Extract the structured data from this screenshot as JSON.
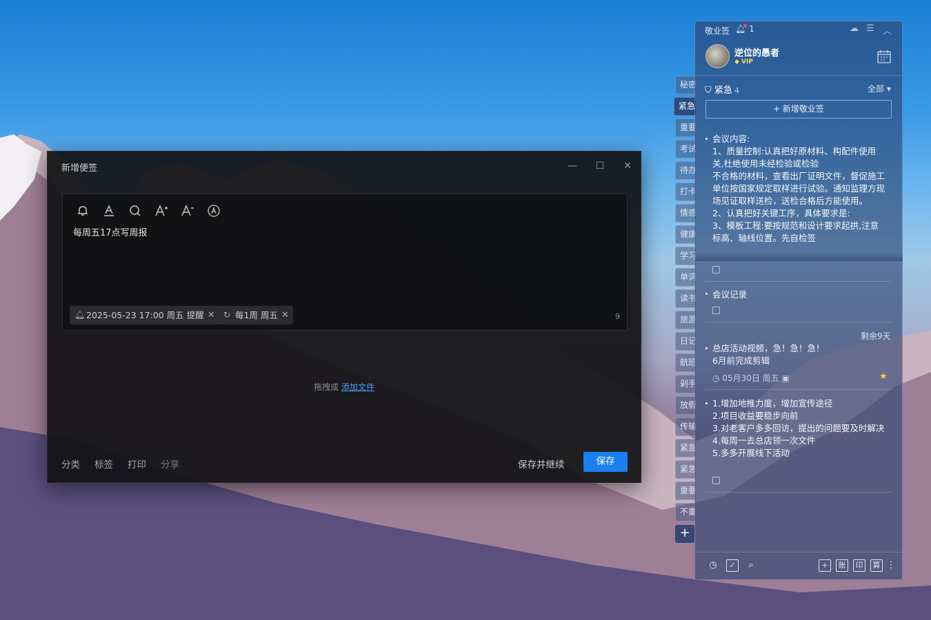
{
  "dialog": {
    "title": "新增便签",
    "content": "每周五17点写周报",
    "reminder_chip": "2025-05-23 17:00 周五 提醒",
    "repeat_chip": "每1周 周五",
    "char_count": "9",
    "drop_text": "拖拽或",
    "drop_link": "添加文件",
    "footer": {
      "category": "分类",
      "tags": "标签",
      "print": "打印",
      "share": "分享"
    },
    "save_continue": "保存并继续",
    "save": "保存"
  },
  "side_tabs": [
    "秘密",
    "紧急",
    "重要",
    "考试",
    "待办",
    "打卡",
    "情感",
    "健康",
    "学习",
    "单词",
    "读书",
    "旅游",
    "日记",
    "航班",
    "剁手",
    "放假",
    "传输",
    "紧急",
    "紧急",
    "重要",
    "不重"
  ],
  "panel": {
    "app_name": "敬业签",
    "bell_count": "1",
    "username": "逆位的愚者",
    "vip": "VIP",
    "category": "紧急",
    "category_count": "4",
    "filter": "全部",
    "new_note": "+ 新增敬业签",
    "notes": [
      {
        "lines": [
          "会议内容:",
          "1、质量控制:认真把好原材料、构配件使用关,杜绝使用未经检验或检验",
          "不合格的材料，查看出厂证明文件，督促施工单位按国家规定取样进行试验。通知监理方现场见证取样送检，送检合格后方能使用。",
          "2、认真把好关键工序，具体要求是:",
          "3、模板工程:要按规范和设计要求起拱,注意标高、轴线位置。先自检签"
        ]
      },
      {
        "lines": [
          "会议记录"
        ]
      },
      {
        "remaining": "剩余9天",
        "lines": [
          "总店活动视频，急！急！急！",
          "6月前完成剪辑"
        ],
        "meta": "05月30日 周五"
      },
      {
        "lines": [
          "1.增加地推力度，增加宣传途径",
          "2.项目收益要稳步向前",
          "3.对老客户多多回访，提出的问题要及时解决",
          "4.每周一去总店领一次文件",
          "5.多多开展线下活动"
        ]
      }
    ],
    "bottom_boxes": [
      "账",
      "印",
      "算"
    ]
  }
}
